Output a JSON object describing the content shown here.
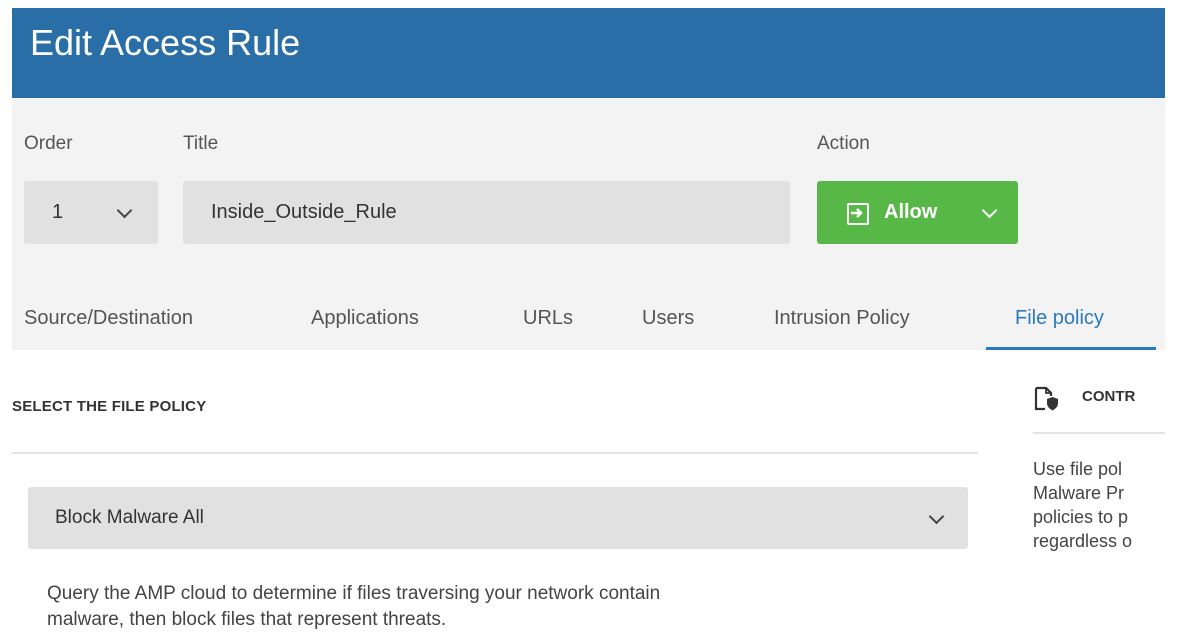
{
  "header": {
    "title": "Edit Access Rule"
  },
  "fields": {
    "order_label": "Order",
    "order_value": "1",
    "title_label": "Title",
    "title_value": "Inside_Outside_Rule",
    "action_label": "Action",
    "action_value": "Allow"
  },
  "tabs": [
    {
      "label": "Source/Destination"
    },
    {
      "label": "Applications"
    },
    {
      "label": "URLs"
    },
    {
      "label": "Users"
    },
    {
      "label": "Intrusion Policy"
    },
    {
      "label": "File policy",
      "active": true
    }
  ],
  "file_policy": {
    "section_title": "SELECT THE FILE POLICY",
    "selected": "Block Malware All",
    "description_line1": "Query the AMP cloud to determine if files traversing your network contain",
    "description_line2": "malware, then block files that represent threats."
  },
  "side_panel": {
    "heading": "CONTR",
    "lines": [
      "Use file pol",
      "Malware Pr",
      "policies to p",
      "regardless o"
    ]
  },
  "colors": {
    "header": "#2a6ea8",
    "allow": "#58b847",
    "active_tab": "#2a7ac0"
  },
  "icons": {
    "action": "allow-arrow-icon",
    "side": "file-shield-icon"
  }
}
